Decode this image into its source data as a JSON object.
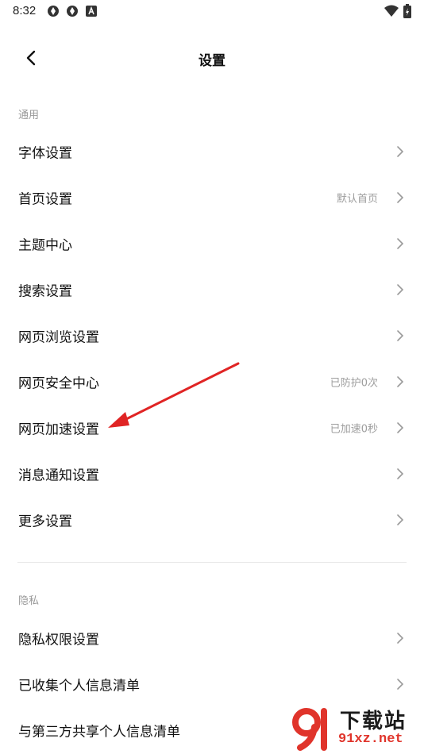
{
  "status_bar": {
    "time": "8:32",
    "icons": [
      "sync-icon",
      "sync-icon",
      "font-icon",
      "wifi-icon",
      "battery-icon"
    ]
  },
  "header": {
    "title": "设置",
    "back_icon": "chevron-left-icon"
  },
  "sections": {
    "general": {
      "label": "通用",
      "items": [
        {
          "label": "字体设置",
          "value": ""
        },
        {
          "label": "首页设置",
          "value": "默认首页"
        },
        {
          "label": "主题中心",
          "value": ""
        },
        {
          "label": "搜索设置",
          "value": ""
        },
        {
          "label": "网页浏览设置",
          "value": ""
        },
        {
          "label": "网页安全中心",
          "value": "已防护0次"
        },
        {
          "label": "网页加速设置",
          "value": "已加速0秒"
        },
        {
          "label": "消息通知设置",
          "value": ""
        },
        {
          "label": "更多设置",
          "value": ""
        }
      ]
    },
    "privacy": {
      "label": "隐私",
      "items": [
        {
          "label": "隐私权限设置",
          "value": ""
        },
        {
          "label": "已收集个人信息清单",
          "value": ""
        },
        {
          "label": "与第三方共享个人信息清单",
          "value": ""
        }
      ]
    }
  },
  "annotation": {
    "color": "#e02424",
    "icon": "arrow-icon"
  },
  "watermark": {
    "title": "下载站",
    "url": "91xz.net",
    "colors": {
      "red": "#e0342b",
      "dark": "#1b1b1b"
    }
  }
}
